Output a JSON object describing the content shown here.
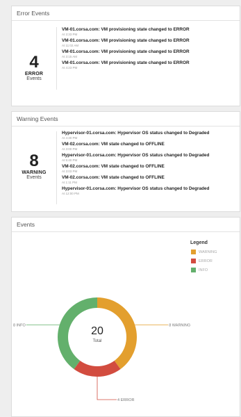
{
  "error_panel": {
    "title": "Error Events",
    "count": "4",
    "level": "ERROR",
    "unit": "Events",
    "items": [
      {
        "text": "VM-01.corsa.com: VM provisioning state changed to ERROR",
        "time": "At 3:33 PM"
      },
      {
        "text": "VM-01.corsa.com: VM provisioning state changed to ERROR",
        "time": "At 11:02 AM"
      },
      {
        "text": "VM-01.corsa.com: VM provisioning state changed to ERROR",
        "time": "At 3:15 AM"
      },
      {
        "text": "VM-01.corsa.com: VM provisioning state changed to ERROR",
        "time": "At 4:23 PM"
      }
    ]
  },
  "warning_panel": {
    "title": "Warning Events",
    "count": "8",
    "level": "WARNING",
    "unit": "Events",
    "items": [
      {
        "text": "Hypervisor-01.corsa.com: Hypervisor OS status changed to Degraded",
        "time": "At 4:30 PM"
      },
      {
        "text": "VM-02.corsa.com: VM state changed to OFFLINE",
        "time": "At 3:00 PM"
      },
      {
        "text": "Hypervisor-01.corsa.com: Hypervisor OS status changed to Degraded",
        "time": "At 5:40 PM"
      },
      {
        "text": "VM-02.corsa.com: VM state changed to OFFLINE",
        "time": "At 3:03 PM"
      },
      {
        "text": "VM-02.corsa.com: VM state changed to OFFLINE",
        "time": "At 1:11 PM"
      },
      {
        "text": "Hypervisor-01.corsa.com: Hypervisor OS status changed to Degraded",
        "time": "At 12:00 PM"
      }
    ]
  },
  "events_panel": {
    "title": "Events",
    "total_value": "20",
    "total_label": "Total",
    "legend_title": "Legend",
    "colors": {
      "warning": "#e39f2e",
      "error": "#d24c3f",
      "info": "#63b06c"
    }
  },
  "chart_data": {
    "type": "pie",
    "categories": [
      "WARNING",
      "ERROR",
      "INFO"
    ],
    "values": [
      8,
      4,
      8
    ],
    "total": 20,
    "labels": [
      "8 WARNING",
      "4 ERROR",
      "8 INFO"
    ],
    "legend_placement": "top-right"
  }
}
